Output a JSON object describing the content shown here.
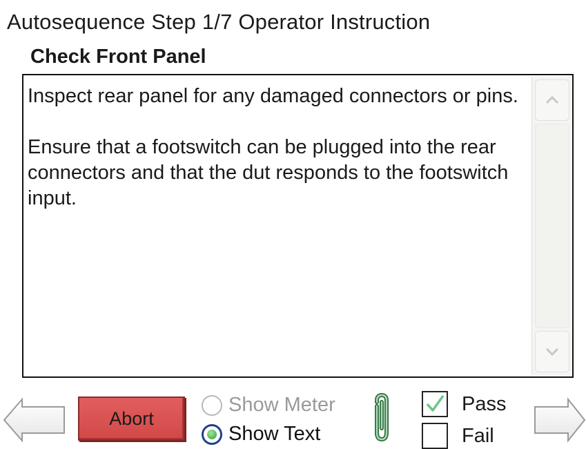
{
  "header": {
    "title": "Autosequence Step 1/7 Operator Instruction",
    "subtitle": "Check Front Panel"
  },
  "instructions": {
    "paragraphs": [
      "Inspect rear panel for any damaged connectors or pins.",
      "Ensure that a footswitch can be plugged into the rear connectors and that the dut responds to the footswitch input."
    ]
  },
  "controls": {
    "abort_label": "Abort",
    "show_meter_label": "Show Meter",
    "show_text_label": "Show Text",
    "selected_view": "Show Text",
    "pass_label": "Pass",
    "fail_label": "Fail",
    "pass_checked": true,
    "fail_checked": false
  },
  "icons": {
    "nav_left": "arrow-left-icon",
    "nav_right": "arrow-right-icon",
    "attachment": "paperclip-icon",
    "scroll_up": "chevron-up-icon",
    "scroll_down": "chevron-down-icon",
    "pass_mark": "checkmark-icon"
  },
  "colors": {
    "abort_button": "#d84f4f",
    "radio_selected_dot": "#2f9f2f",
    "checkmark": "#5fbf7a",
    "paperclip": "#3a7a4a"
  }
}
